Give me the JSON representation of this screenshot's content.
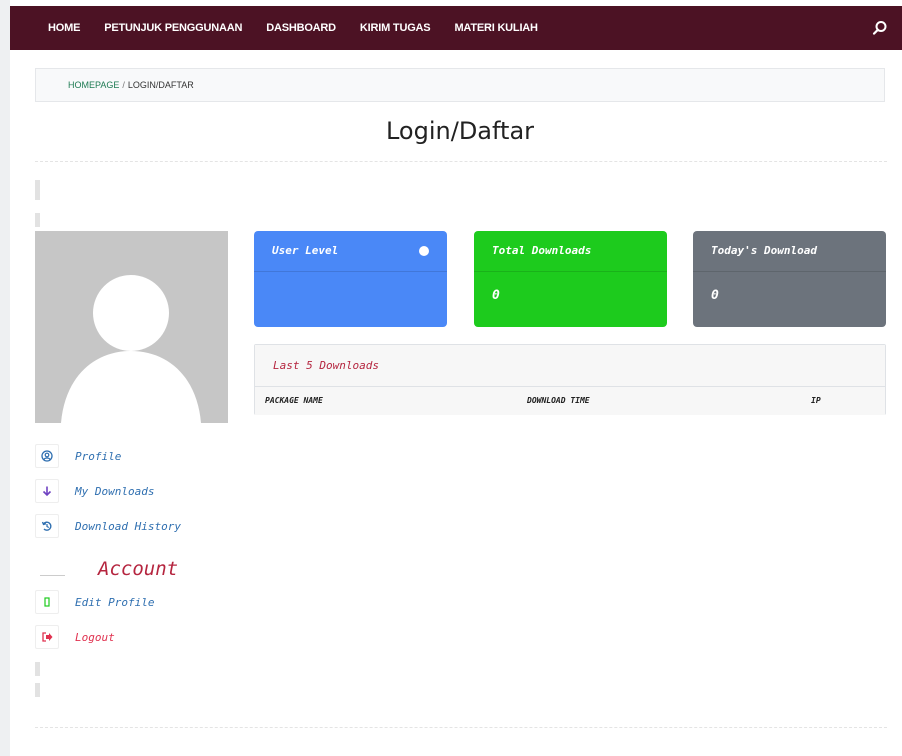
{
  "nav": {
    "items": [
      "HOME",
      "PETUNJUK PENGGUNAAN",
      "DASHBOARD",
      "KIRIM TUGAS",
      "MATERI KULIAH"
    ],
    "search_icon": "search-icon"
  },
  "breadcrumb": {
    "home": "HOMEPAGE",
    "separator": "/",
    "current": "LOGIN/DAFTAR"
  },
  "page": {
    "title": "Login/Daftar"
  },
  "cards": {
    "user_level": {
      "label": "User Level",
      "value": ""
    },
    "total_downloads": {
      "label": "Total Downloads",
      "value": "0"
    },
    "today_download": {
      "label": "Today's Download",
      "value": "0"
    }
  },
  "downloads": {
    "title": "Last 5 Downloads",
    "columns": [
      "PACKAGE NAME",
      "DOWNLOAD TIME",
      "IP"
    ]
  },
  "menu": {
    "profile": "Profile",
    "my_downloads": "My Downloads",
    "download_history": "Download History",
    "account_heading": "Account",
    "edit_profile": "Edit Profile",
    "logout": "Logout"
  },
  "colors": {
    "navbar": "#4c1224",
    "card_blue": "#4a88f7",
    "card_green": "#1dcb1d",
    "card_gray": "#6c737c",
    "accent_red": "#b5253f",
    "menu_blue": "#2f6fb0"
  }
}
